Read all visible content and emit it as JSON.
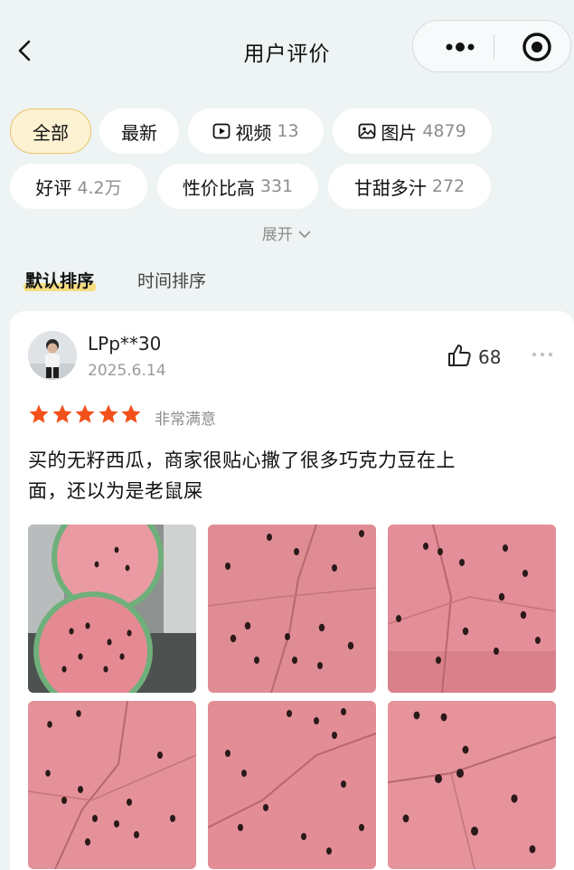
{
  "header": {
    "title": "用户评价"
  },
  "filters": [
    {
      "label": "全部",
      "count": "",
      "icon": "",
      "active": true
    },
    {
      "label": "最新",
      "count": "",
      "icon": "",
      "active": false
    },
    {
      "label": "视频",
      "count": "13",
      "icon": "video-icon",
      "active": false
    },
    {
      "label": "图片",
      "count": "4879",
      "icon": "image-icon",
      "active": false
    },
    {
      "label": "好评",
      "count": "4.2万",
      "icon": "",
      "active": false
    },
    {
      "label": "性价比高",
      "count": "331",
      "icon": "",
      "active": false
    },
    {
      "label": "甘甜多汁",
      "count": "272",
      "icon": "",
      "active": false
    }
  ],
  "expand_label": "展开",
  "sort": {
    "default_label": "默认排序",
    "time_label": "时间排序"
  },
  "review": {
    "username": "LPp**30",
    "date": "2025.6.14",
    "likes": "68",
    "rating": 5,
    "rating_text": "非常满意",
    "text_line1": "买的无籽西瓜，商家很贴心撒了很多巧克力豆在上",
    "text_line2": "面，还以为是老鼠屎",
    "photo_count": 6
  },
  "colors": {
    "accent_chip_bg": "#fdf2d2",
    "accent_chip_border": "#e8c46a",
    "star": "#f2511b",
    "sort_highlight": "#f8d65a",
    "watermelon_flesh": "#e58a93",
    "seed": "#2a1a1a"
  }
}
